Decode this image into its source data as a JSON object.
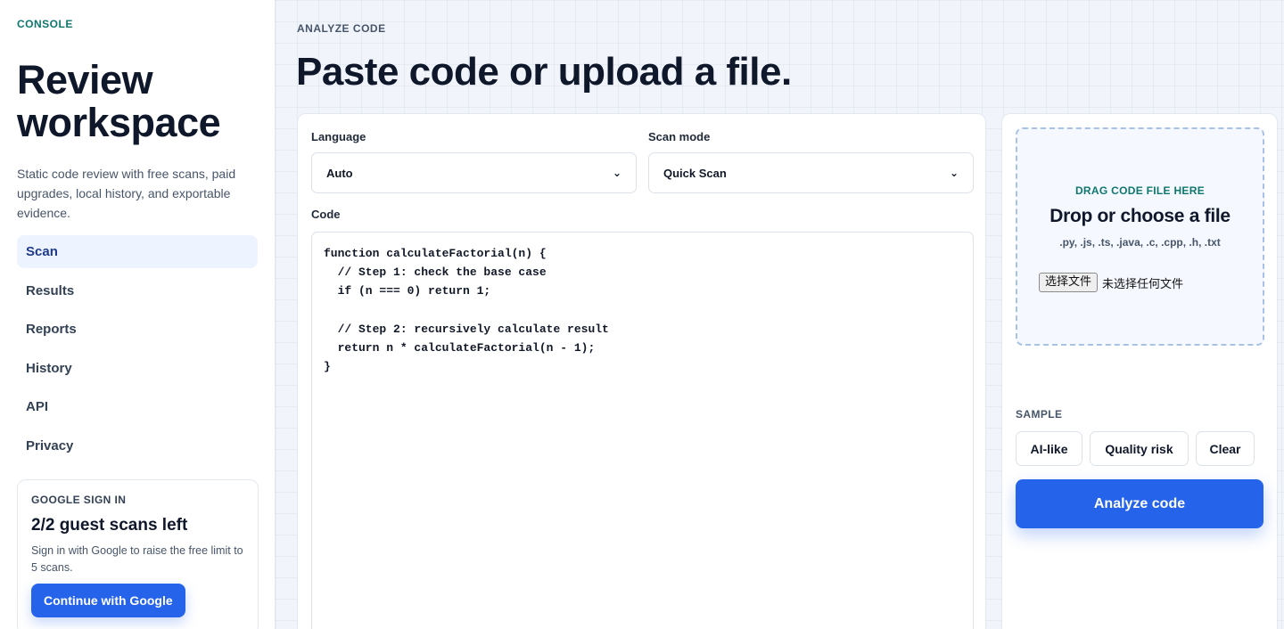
{
  "sidebar": {
    "kicker": "CONSOLE",
    "title": "Review workspace",
    "description": "Static code review with free scans, paid upgrades, local history, and exportable evidence.",
    "nav": [
      {
        "label": "Scan",
        "active": true
      },
      {
        "label": "Results"
      },
      {
        "label": "Reports"
      },
      {
        "label": "History"
      },
      {
        "label": "API"
      },
      {
        "label": "Privacy"
      }
    ],
    "signin": {
      "kicker": "GOOGLE SIGN IN",
      "title": "2/2 guest scans left",
      "description": "Sign in with Google to raise the free limit to 5 scans.",
      "button": "Continue with Google"
    }
  },
  "main": {
    "kicker": "ANALYZE CODE",
    "title": "Paste code or upload a file.",
    "language": {
      "label": "Language",
      "value": "Auto"
    },
    "scan_mode": {
      "label": "Scan mode",
      "value": "Quick Scan"
    },
    "code": {
      "label": "Code",
      "value": "function calculateFactorial(n) {\n  // Step 1: check the base case\n  if (n === 0) return 1;\n\n  // Step 2: recursively calculate result\n  return n * calculateFactorial(n - 1);\n}"
    },
    "dropzone": {
      "kicker": "DRAG CODE FILE HERE",
      "title": "Drop or choose a file",
      "types": ".py, .js, .ts, .java, .c, .cpp, .h, .txt",
      "choose_button": "选择文件",
      "file_status": "未选择任何文件"
    },
    "sample": {
      "label": "SAMPLE",
      "buttons": [
        "AI-like",
        "Quality risk",
        "Clear"
      ]
    },
    "analyze_button": "Analyze code"
  },
  "colors": {
    "accent": "#2563eb",
    "teal": "#0f766e",
    "nav_active_bg": "#eef4ff"
  }
}
